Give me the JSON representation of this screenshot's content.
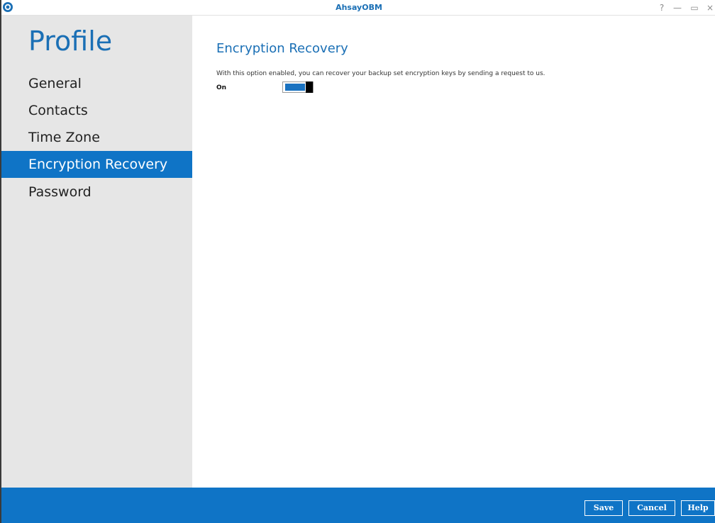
{
  "window": {
    "title": "AhsayOBM",
    "controls": {
      "help": "?",
      "minimize": "—",
      "maximize": "▭",
      "close": "×"
    }
  },
  "sidebar": {
    "title": "Profile",
    "items": [
      {
        "label": "General"
      },
      {
        "label": "Contacts"
      },
      {
        "label": "Time Zone"
      },
      {
        "label": "Encryption Recovery",
        "active": true
      },
      {
        "label": "Password"
      }
    ]
  },
  "main": {
    "section_title": "Encryption Recovery",
    "description": "With this option enabled, you can recover your backup set encryption keys by sending a request to us.",
    "toggle": {
      "label": "On",
      "state": true
    }
  },
  "footer": {
    "save_label": "Save",
    "cancel_label": "Cancel",
    "help_label": "Help"
  },
  "colors": {
    "accent": "#0f74c6",
    "title_blue": "#1a6fb5",
    "sidebar_bg": "#e6e6e6"
  }
}
